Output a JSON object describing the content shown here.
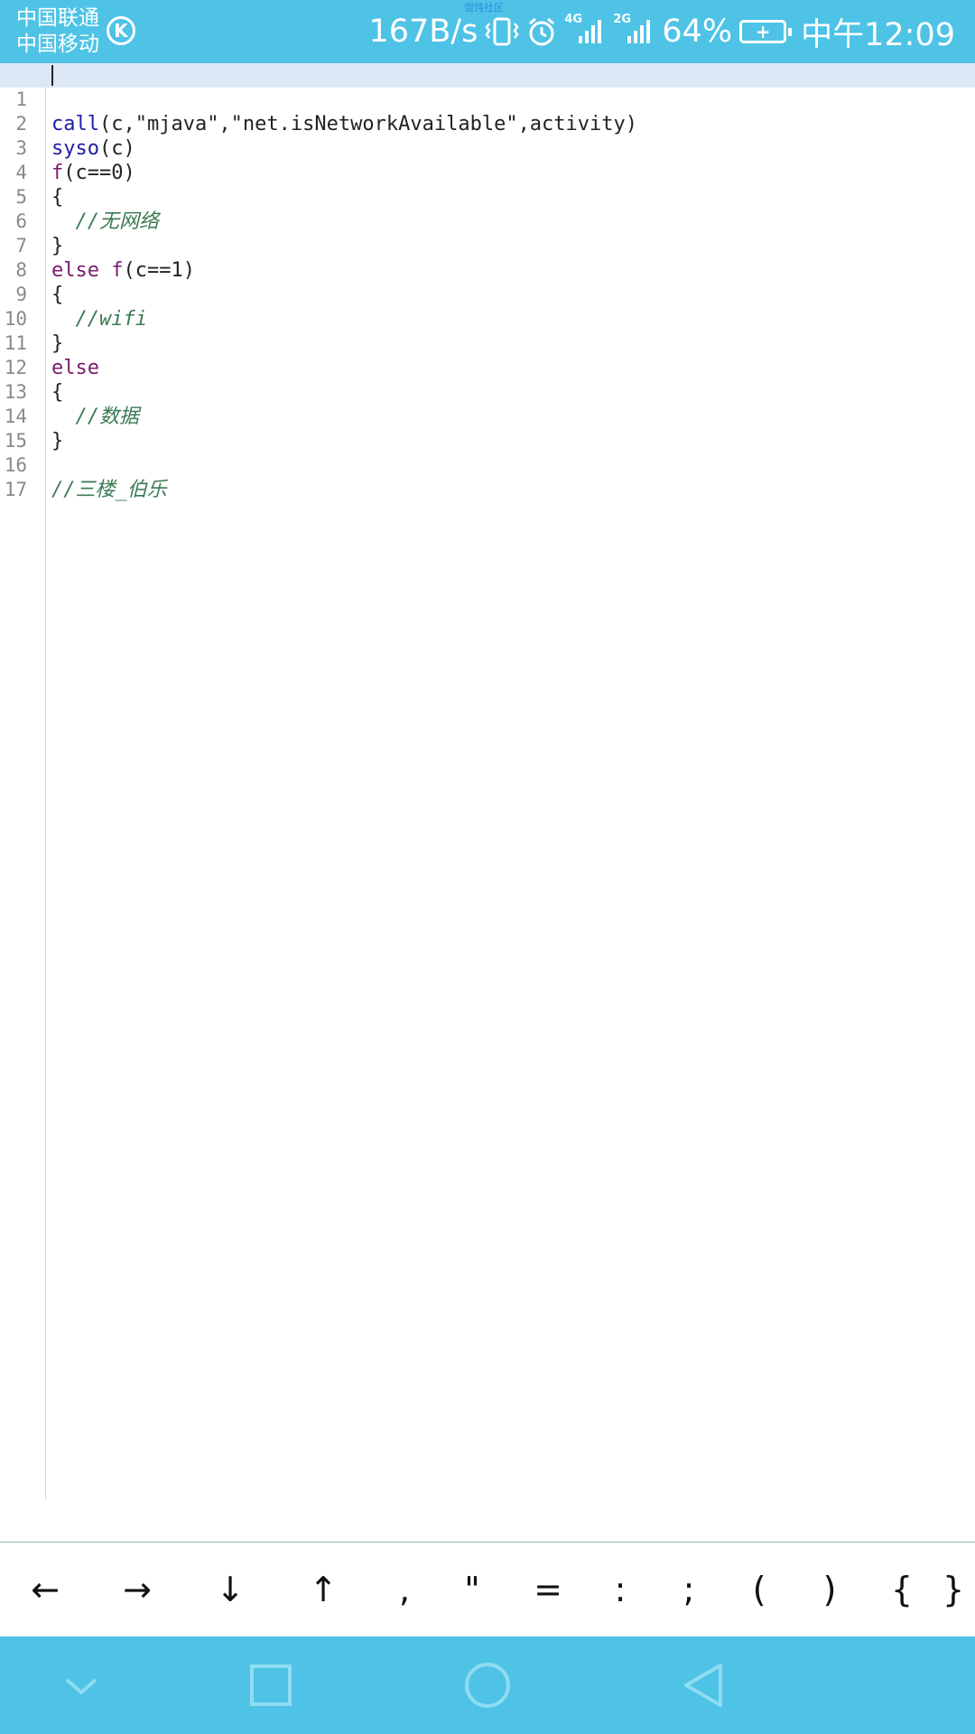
{
  "status_bar": {
    "carrier_1": "中国联通",
    "carrier_2": "中国移动",
    "app_badge": "K",
    "top_tiny_label": "馄饨社区",
    "net_speed": "167B/s",
    "signal_1": "4G",
    "signal_2": "2G",
    "battery_percent": "64%",
    "time": "中午12:09",
    "icons": [
      "vibrate-icon",
      "alarm-icon",
      "signal-4g-icon",
      "signal-2g-icon",
      "battery-charging-icon"
    ]
  },
  "editor": {
    "current_line": 1,
    "lines": [
      {
        "num": "1",
        "a": "call",
        "b": "(c,\"mjava\",\"net.isNetworkAvailable\",activity)"
      },
      {
        "num": "2",
        "a": "syso",
        "b": "(c)"
      },
      {
        "num": "3",
        "a": "f",
        "b": "(c==0)"
      },
      {
        "num": "4",
        "text": "{"
      },
      {
        "num": "5",
        "comment": "  //无网络"
      },
      {
        "num": "6",
        "text": "}"
      },
      {
        "num": "7",
        "a": "else f",
        "b": "(c==1)"
      },
      {
        "num": "8",
        "text": "{"
      },
      {
        "num": "9",
        "comment": "  //wifi"
      },
      {
        "num": "10",
        "text": "}"
      },
      {
        "num": "11",
        "a": "else"
      },
      {
        "num": "12",
        "text": "{"
      },
      {
        "num": "13",
        "comment": "  //数据"
      },
      {
        "num": "14",
        "text": "}"
      },
      {
        "num": "15",
        "text": ""
      },
      {
        "num": "16",
        "comment": "//三楼_伯乐"
      },
      {
        "num": "17",
        "text": ""
      }
    ]
  },
  "symbol_bar": {
    "keys": [
      "←",
      "→",
      "↓",
      "↑",
      ",",
      "\"",
      "=",
      ":",
      ";",
      "(",
      ")",
      "{",
      "}"
    ]
  },
  "nav_bar": {
    "buttons": [
      "hide-keyboard-icon",
      "recents-icon",
      "home-icon",
      "back-icon"
    ]
  },
  "colors": {
    "status_bar_bg": "#4ec3e6",
    "keyword_blue": "#1e1ea8",
    "keyword_purple": "#7a1b6a",
    "comment_green": "#3a7a52",
    "current_line_bg": "#dde8f6"
  }
}
